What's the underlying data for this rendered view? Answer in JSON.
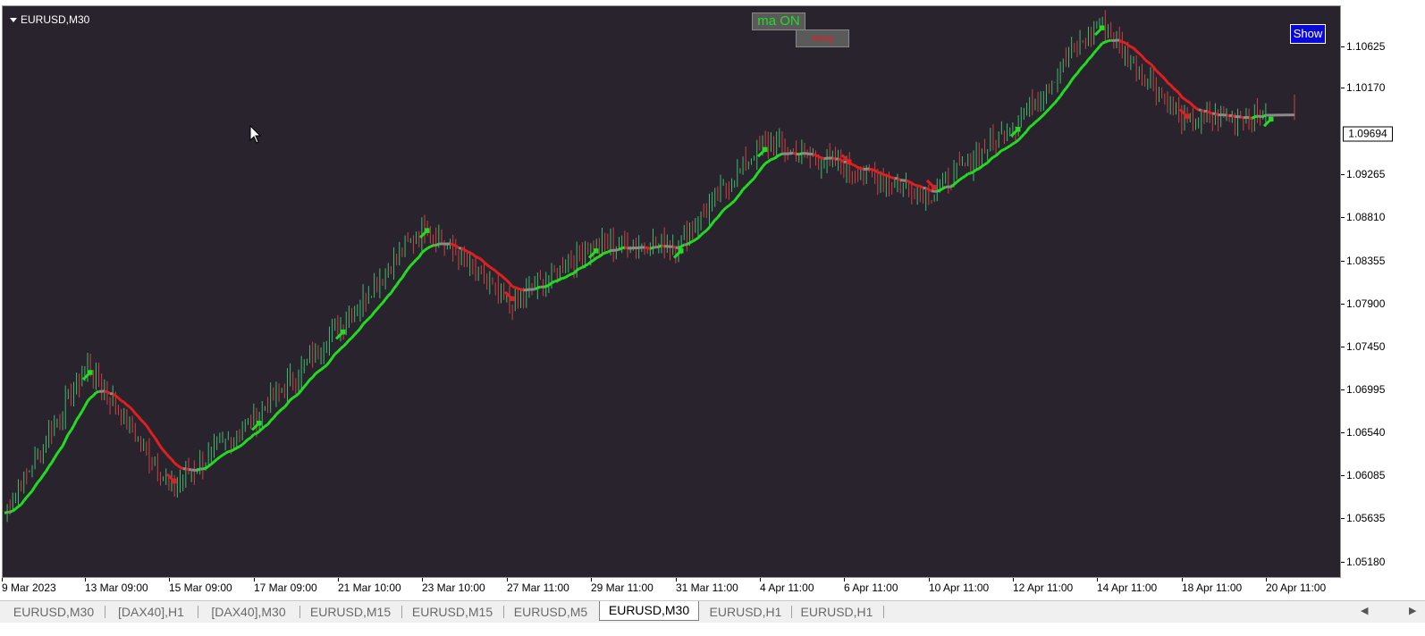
{
  "window": {
    "symbol_title": "EURUSD,M30",
    "ma_button_label": "ma ON",
    "eavg_button_label": "eavg",
    "show_button_label": "Show",
    "current_price": "1.09694"
  },
  "colors": {
    "background": "#28232d",
    "bull_candle": "#3dbb6a",
    "bear_candle": "#d04040",
    "ma_up": "#22dd22",
    "ma_down": "#e02020",
    "ma_flat": "#8a8a8a"
  },
  "price_axis": {
    "ticks": [
      "1.10625",
      "1.10170",
      "1.09265",
      "1.08810",
      "1.08355",
      "1.07900",
      "1.07450",
      "1.06995",
      "1.06540",
      "1.06085",
      "1.05635",
      "1.05180"
    ]
  },
  "time_axis": {
    "ticks": [
      "9 Mar 2023",
      "13 Mar 09:00",
      "15 Mar 09:00",
      "17 Mar 09:00",
      "21 Mar 10:00",
      "23 Mar 10:00",
      "27 Mar 11:00",
      "29 Mar 11:00",
      "31 Mar 11:00",
      "4 Apr 11:00",
      "6 Apr 11:00",
      "10 Apr 11:00",
      "12 Apr 11:00",
      "14 Apr 11:00",
      "18 Apr 11:00",
      "20 Apr 11:00"
    ]
  },
  "tabs": [
    {
      "label": "EURUSD,M30",
      "active": false
    },
    {
      "label": "[DAX40],H1",
      "active": false
    },
    {
      "label": "[DAX40],M30",
      "active": false
    },
    {
      "label": "EURUSD,M15",
      "active": false
    },
    {
      "label": "EURUSD,M15",
      "active": false
    },
    {
      "label": "EURUSD,M5",
      "active": false
    },
    {
      "label": "EURUSD,M30",
      "active": true
    },
    {
      "label": "EURUSD,H1",
      "active": false
    },
    {
      "label": "EURUSD,H1",
      "active": false
    }
  ],
  "chart_data": {
    "type": "line",
    "x": [
      "9 Mar 2023",
      "13 Mar 09:00",
      "15 Mar 09:00",
      "17 Mar 09:00",
      "21 Mar 10:00",
      "23 Mar 10:00",
      "27 Mar 11:00",
      "29 Mar 11:00",
      "31 Mar 11:00",
      "4 Apr 11:00",
      "6 Apr 11:00",
      "10 Apr 11:00",
      "12 Apr 11:00",
      "14 Apr 11:00",
      "18 Apr 11:00",
      "20 Apr 11:00"
    ],
    "series": [
      {
        "values": [
          1.0575,
          1.072,
          1.06,
          1.067,
          1.076,
          1.086,
          1.078,
          1.084,
          1.084,
          1.094,
          1.0915,
          1.089,
          1.096,
          1.106,
          1.096,
          1.097
        ]
      }
    ],
    "ylim": [
      1.051,
      1.1075
    ],
    "grid": false
  }
}
